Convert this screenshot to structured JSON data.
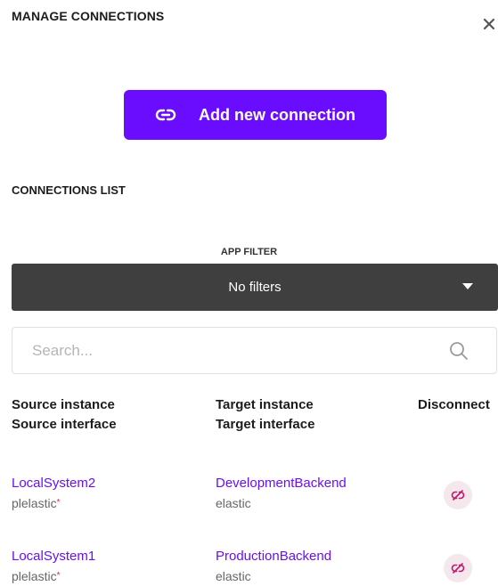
{
  "header": {
    "title": "MANAGE CONNECTIONS"
  },
  "actions": {
    "add_label": "Add new connection"
  },
  "list": {
    "title": "CONNECTIONS LIST"
  },
  "filter": {
    "label": "APP FILTER",
    "value": "No filters"
  },
  "search": {
    "placeholder": "Search..."
  },
  "columns": {
    "source_instance": "Source instance",
    "source_interface": "Source interface",
    "target_instance": "Target instance",
    "target_interface": "Target interface",
    "disconnect": "Disconnect"
  },
  "rows": [
    {
      "source_instance": "LocalSystem2",
      "source_interface": "plelastic",
      "required_mark": "*",
      "target_instance": "DevelopmentBackend",
      "target_interface": "elastic"
    },
    {
      "source_instance": "LocalSystem1",
      "source_interface": "plelastic",
      "required_mark": "*",
      "target_instance": "ProductionBackend",
      "target_interface": "elastic"
    }
  ],
  "colors": {
    "accent": "#6a0dff",
    "dark": "#3f3f3f",
    "required": "#e0177a",
    "disconnect_bg": "#f4e8ec",
    "disconnect_icon": "#c2186b"
  },
  "icons": {
    "close": "close-icon",
    "add": "link-icon",
    "search": "search-icon",
    "disconnect": "unlink-icon"
  }
}
